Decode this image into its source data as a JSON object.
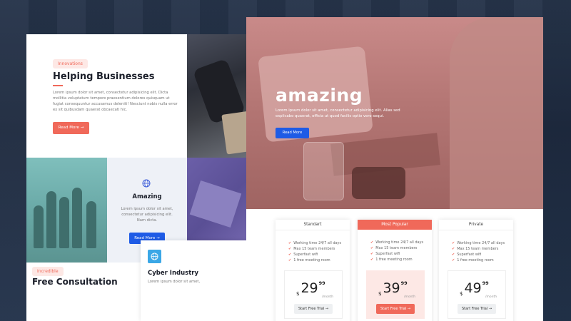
{
  "left": {
    "hero": {
      "badge": "Innovations",
      "title": "Helping Businesses",
      "body": "Lorem ipsum dolor sit amet, consectetur adipisicing elit. Dicta mollitia voluptatum tempore praesentium dolores quisquam ut fugiat consequuntur accusamus deleniti! Nesciunt nobis nulla error ex sit quibusdam quaerat obcaecati hic.",
      "button": "Read More"
    },
    "amazing_card": {
      "title": "Amazing",
      "body": "Lorem ipsum dolor sit amet, consectetur adipisicing elit. Nam dicta.",
      "button": "Read More"
    },
    "consultation": {
      "badge": "Incredible",
      "title": "Free Consultation"
    },
    "cyber_card": {
      "title": "Cyber Industry",
      "body": "Lorem ipsum dolor sit amet,"
    }
  },
  "right": {
    "hero": {
      "title": "amazing",
      "body": "Lorem ipsum dolor sit amet, consectetur adipisicing elit. Alias sed explicabo quaerat, officia ut quod facilis optio vero sequi.",
      "button": "Read More"
    },
    "plans": [
      {
        "name": "Standart",
        "features": [
          "Working time 24/7 all days",
          "Max 15 team members",
          "Superfast wifi",
          "1 free meeting room"
        ],
        "currency": "$",
        "price": "29",
        "cents": "99",
        "period": "/month",
        "button": "Start Free Trial"
      },
      {
        "name": "Most Popular",
        "features": [
          "Working time 24/7 all days",
          "Max 15 team members",
          "Superfast wifi",
          "1 free meeting room"
        ],
        "currency": "$",
        "price": "39",
        "cents": "99",
        "period": "/month",
        "button": "Start Free Trial"
      },
      {
        "name": "Private",
        "features": [
          "Working time 24/7 all days",
          "Max 15 team members",
          "Superfast wifi",
          "1 free meeting room"
        ],
        "currency": "$",
        "price": "49",
        "cents": "99",
        "period": "/month",
        "button": "Start Free Trial"
      }
    ]
  },
  "colors": {
    "accent_red": "#f0695a",
    "accent_blue": "#1e5be6",
    "hero_tint": "#c98a89",
    "teal_tint": "#7fbfbc",
    "purple_tint": "#6b5fa8",
    "card_icon_blue": "#3aa7e6"
  }
}
